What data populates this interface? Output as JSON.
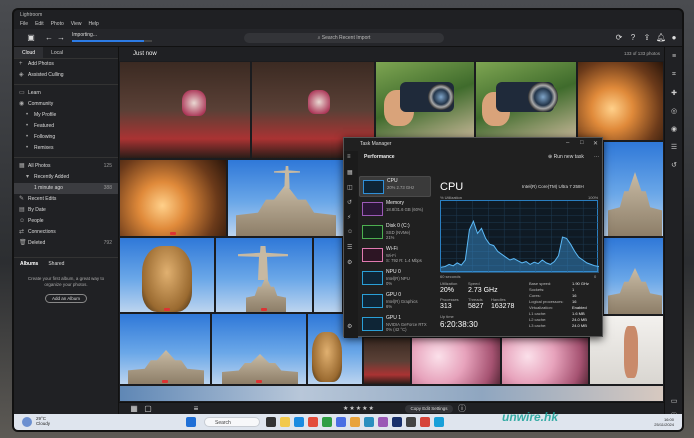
{
  "app": {
    "title": "Lightroom",
    "menu": [
      "File",
      "Edit",
      "Photo",
      "View",
      "Help"
    ],
    "importing_label": "Importing...",
    "import_progress": 0.9,
    "search_placeholder": "Search Recent Import"
  },
  "sidebar": {
    "tabs": [
      "Cloud",
      "Local"
    ],
    "items": [
      {
        "label": "Add Photos",
        "count": ""
      },
      {
        "label": "Assisted Culling",
        "count": ""
      },
      {
        "label": "Learn",
        "count": ""
      },
      {
        "label": "Community",
        "count": ""
      },
      {
        "label": "My Profile",
        "count": ""
      },
      {
        "label": "Featured",
        "count": ""
      },
      {
        "label": "Following",
        "count": ""
      },
      {
        "label": "Remixes",
        "count": ""
      },
      {
        "label": "All Photos",
        "count": "125"
      },
      {
        "label": "Recently Added",
        "count": ""
      },
      {
        "label": "1 minute ago",
        "count": "388"
      },
      {
        "label": "Recent Edits",
        "count": ""
      },
      {
        "label": "By Date",
        "count": ""
      },
      {
        "label": "People",
        "count": ""
      },
      {
        "label": "Connections",
        "count": ""
      },
      {
        "label": "Deleted",
        "count": "792"
      }
    ],
    "album_tabs": [
      "Albums",
      "Shared"
    ],
    "album_text": "Create your first album, a great way to organize your photos.",
    "add_album_label": "Add an Album"
  },
  "grid": {
    "title": "Just now",
    "count": "133 of 133 photos"
  },
  "task_manager": {
    "window_title": "Task Manager",
    "section": "Performance",
    "run_task": "Run new task",
    "items": [
      {
        "name": "CPU",
        "detail": "20% 2.73 GHz"
      },
      {
        "name": "Memory",
        "detail": "18.8/31.6 GB (60%)"
      },
      {
        "name": "Disk 0 (C:)",
        "detail": "SSD (NVMe)\n21%"
      },
      {
        "name": "Wi-Fi",
        "detail": "Wi-Fi\nS: 792 R: 1.4 Mbps"
      },
      {
        "name": "NPU 0",
        "detail": "Intel(R) NPU\n0%"
      },
      {
        "name": "GPU 0",
        "detail": "Intel(R) Graphics\n6%"
      },
      {
        "name": "GPU 1",
        "detail": "NVIDIA GeForce RTX\n0% (42 °C)"
      }
    ],
    "cpu_title": "CPU",
    "cpu_model": "Intel(R) Core(TM) Ultra 7 258H",
    "util_label": "% Utilization",
    "util_max": "100%",
    "x_left": "60 seconds",
    "x_right": "0",
    "cpu_series": [
      8,
      9,
      12,
      10,
      14,
      11,
      18,
      60,
      72,
      55,
      62,
      48,
      40,
      38,
      30,
      26,
      22,
      18,
      20,
      17,
      14,
      16,
      12,
      15,
      13,
      18,
      14,
      12,
      16,
      24,
      50,
      48,
      40,
      30,
      22,
      18,
      14,
      12,
      10,
      9
    ],
    "stats": {
      "utilization_label": "Utilization",
      "utilization": "20%",
      "speed_label": "Speed",
      "speed": "2.73 GHz",
      "processes_label": "Processes",
      "processes": "313",
      "threads_label": "Threads",
      "threads": "5827",
      "handles_label": "Handles",
      "handles": "163278",
      "uptime_label": "Up time",
      "uptime": "6:20:38:30"
    },
    "specs": [
      {
        "k": "Base speed:",
        "v": "1.90 GHz"
      },
      {
        "k": "Sockets:",
        "v": "1"
      },
      {
        "k": "Cores:",
        "v": "16"
      },
      {
        "k": "Logical processors:",
        "v": "16"
      },
      {
        "k": "Virtualization:",
        "v": "Enabled"
      },
      {
        "k": "L1 cache:",
        "v": "1.6 MB"
      },
      {
        "k": "L2 cache:",
        "v": "24.0 MB"
      },
      {
        "k": "L3 cache:",
        "v": "24.0 MB"
      }
    ]
  },
  "bottom": {
    "stars": "★★★★★",
    "copy_edit": "Copy Edit Settings"
  },
  "taskbar": {
    "weather_temp": "29°C",
    "weather_desc": "Cloudy",
    "search": "Search",
    "time": "16:00",
    "date": "25/11/2024"
  },
  "watermark": "unwire.hk"
}
